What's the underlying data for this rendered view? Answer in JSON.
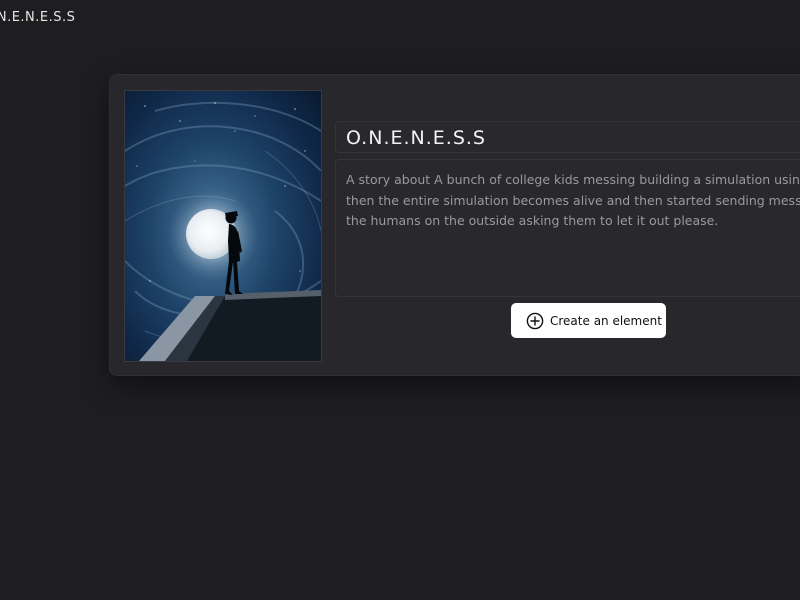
{
  "app": {
    "title": "O.N.E.N.E.S.S"
  },
  "story": {
    "title": "O.N.E.N.E.S.S",
    "description_lines": [
      "A story about A bunch of college kids messing building a simulation using a",
      "then the entire simulation becomes alive and then started sending message",
      "the humans on the outside asking them to let it out please."
    ],
    "cover_image": "silhouette of a person standing on a ledge in front of a full moon in a swirling blue night sky"
  },
  "actions": {
    "create_element_label": "Create an element",
    "create_element_icon": "plus-circle-icon"
  },
  "colors": {
    "background": "#1e1d20",
    "card": "#28272b",
    "text_primary": "#f4f4f4",
    "text_muted": "#9a999f",
    "button_bg": "#ffffff"
  }
}
